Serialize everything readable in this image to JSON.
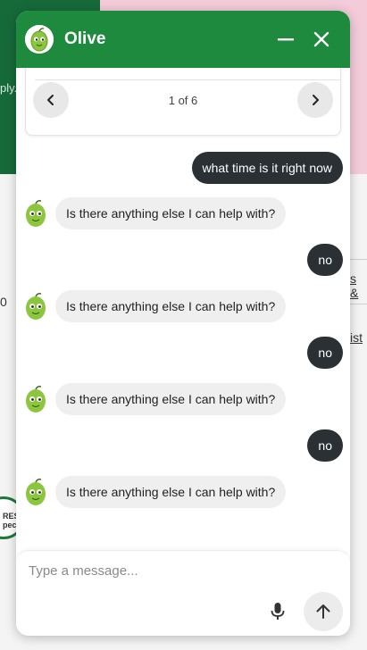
{
  "background": {
    "left_text": "ply.",
    "number": "0",
    "link1": "s &",
    "link2": "ist",
    "badge_line1": "RES",
    "badge_line2": "peci"
  },
  "chat": {
    "title": "Olive",
    "carousel": {
      "counter": "1 of 6"
    },
    "messages": [
      {
        "role": "user",
        "text": "what time is it right now"
      },
      {
        "role": "bot",
        "text": "Is there anything else I can help with?"
      },
      {
        "role": "user",
        "text": "no"
      },
      {
        "role": "bot",
        "text": "Is there anything else I can help with?"
      },
      {
        "role": "user",
        "text": "no"
      },
      {
        "role": "bot",
        "text": "Is there anything else I can help with?"
      },
      {
        "role": "user",
        "text": "no"
      },
      {
        "role": "bot",
        "text": "Is there anything else I can help with?"
      }
    ],
    "composer": {
      "placeholder": "Type a message..."
    }
  },
  "colors": {
    "header": "#1e8a3e",
    "user_bubble": "#2a3034",
    "bot_bubble": "#efefef"
  },
  "icons": {
    "avatar": "olive-icon",
    "minimize": "minimize-icon",
    "close": "close-icon",
    "prev": "chevron-left-icon",
    "next": "chevron-right-icon",
    "mic": "microphone-icon",
    "send": "arrow-up-icon"
  }
}
